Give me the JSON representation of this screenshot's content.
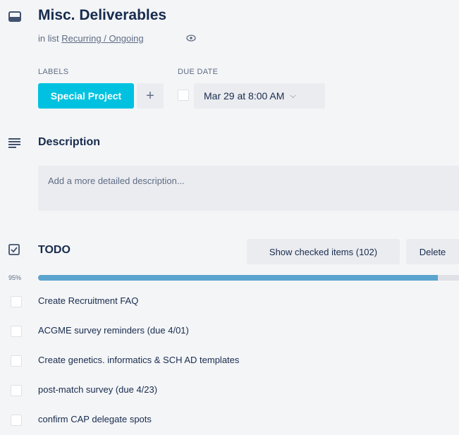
{
  "card": {
    "title": "Misc. Deliverables",
    "in_list_prefix": "in list",
    "list_name": "Recurring / Ongoing",
    "icon": "card-icon",
    "watch_icon": "eye-icon"
  },
  "labels": {
    "heading": "LABELS",
    "items": [
      {
        "name": "Special Project",
        "color": "#00c2e0"
      }
    ],
    "add_label": "+"
  },
  "due_date": {
    "heading": "DUE DATE",
    "value": "Mar 29 at 8:00 AM",
    "completed": false
  },
  "description": {
    "heading": "Description",
    "placeholder": "Add a more detailed description..."
  },
  "checklist": {
    "title": "TODO",
    "show_checked_label": "Show checked items (102)",
    "delete_label": "Delete",
    "progress_label": "95%",
    "progress": 0.95,
    "progress_color": "#5ba4cf",
    "items": [
      {
        "text": "Create Recruitment FAQ",
        "checked": false
      },
      {
        "text": "ACGME survey reminders (due 4/01)",
        "checked": false
      },
      {
        "text": "Create genetics. informatics & SCH AD templates",
        "checked": false
      },
      {
        "text": "post-match survey (due 4/23)",
        "checked": false
      },
      {
        "text": "confirm CAP delegate spots",
        "checked": false
      }
    ]
  }
}
